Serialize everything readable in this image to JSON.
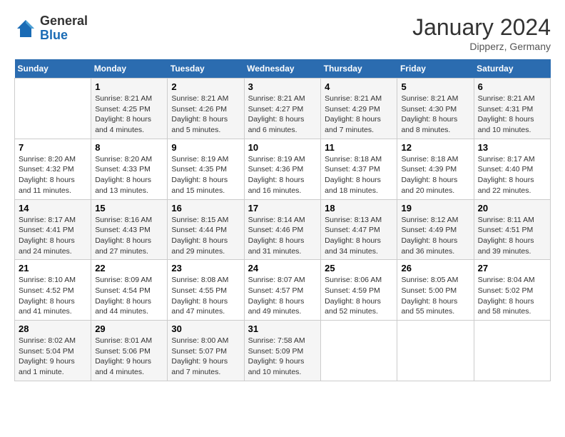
{
  "header": {
    "logo_line1": "General",
    "logo_line2": "Blue",
    "month": "January 2024",
    "location": "Dipperz, Germany"
  },
  "weekdays": [
    "Sunday",
    "Monday",
    "Tuesday",
    "Wednesday",
    "Thursday",
    "Friday",
    "Saturday"
  ],
  "weeks": [
    [
      {
        "day": "",
        "sunrise": "",
        "sunset": "",
        "daylight": ""
      },
      {
        "day": "1",
        "sunrise": "Sunrise: 8:21 AM",
        "sunset": "Sunset: 4:25 PM",
        "daylight": "Daylight: 8 hours and 4 minutes."
      },
      {
        "day": "2",
        "sunrise": "Sunrise: 8:21 AM",
        "sunset": "Sunset: 4:26 PM",
        "daylight": "Daylight: 8 hours and 5 minutes."
      },
      {
        "day": "3",
        "sunrise": "Sunrise: 8:21 AM",
        "sunset": "Sunset: 4:27 PM",
        "daylight": "Daylight: 8 hours and 6 minutes."
      },
      {
        "day": "4",
        "sunrise": "Sunrise: 8:21 AM",
        "sunset": "Sunset: 4:29 PM",
        "daylight": "Daylight: 8 hours and 7 minutes."
      },
      {
        "day": "5",
        "sunrise": "Sunrise: 8:21 AM",
        "sunset": "Sunset: 4:30 PM",
        "daylight": "Daylight: 8 hours and 8 minutes."
      },
      {
        "day": "6",
        "sunrise": "Sunrise: 8:21 AM",
        "sunset": "Sunset: 4:31 PM",
        "daylight": "Daylight: 8 hours and 10 minutes."
      }
    ],
    [
      {
        "day": "7",
        "sunrise": "Sunrise: 8:20 AM",
        "sunset": "Sunset: 4:32 PM",
        "daylight": "Daylight: 8 hours and 11 minutes."
      },
      {
        "day": "8",
        "sunrise": "Sunrise: 8:20 AM",
        "sunset": "Sunset: 4:33 PM",
        "daylight": "Daylight: 8 hours and 13 minutes."
      },
      {
        "day": "9",
        "sunrise": "Sunrise: 8:19 AM",
        "sunset": "Sunset: 4:35 PM",
        "daylight": "Daylight: 8 hours and 15 minutes."
      },
      {
        "day": "10",
        "sunrise": "Sunrise: 8:19 AM",
        "sunset": "Sunset: 4:36 PM",
        "daylight": "Daylight: 8 hours and 16 minutes."
      },
      {
        "day": "11",
        "sunrise": "Sunrise: 8:18 AM",
        "sunset": "Sunset: 4:37 PM",
        "daylight": "Daylight: 8 hours and 18 minutes."
      },
      {
        "day": "12",
        "sunrise": "Sunrise: 8:18 AM",
        "sunset": "Sunset: 4:39 PM",
        "daylight": "Daylight: 8 hours and 20 minutes."
      },
      {
        "day": "13",
        "sunrise": "Sunrise: 8:17 AM",
        "sunset": "Sunset: 4:40 PM",
        "daylight": "Daylight: 8 hours and 22 minutes."
      }
    ],
    [
      {
        "day": "14",
        "sunrise": "Sunrise: 8:17 AM",
        "sunset": "Sunset: 4:41 PM",
        "daylight": "Daylight: 8 hours and 24 minutes."
      },
      {
        "day": "15",
        "sunrise": "Sunrise: 8:16 AM",
        "sunset": "Sunset: 4:43 PM",
        "daylight": "Daylight: 8 hours and 27 minutes."
      },
      {
        "day": "16",
        "sunrise": "Sunrise: 8:15 AM",
        "sunset": "Sunset: 4:44 PM",
        "daylight": "Daylight: 8 hours and 29 minutes."
      },
      {
        "day": "17",
        "sunrise": "Sunrise: 8:14 AM",
        "sunset": "Sunset: 4:46 PM",
        "daylight": "Daylight: 8 hours and 31 minutes."
      },
      {
        "day": "18",
        "sunrise": "Sunrise: 8:13 AM",
        "sunset": "Sunset: 4:47 PM",
        "daylight": "Daylight: 8 hours and 34 minutes."
      },
      {
        "day": "19",
        "sunrise": "Sunrise: 8:12 AM",
        "sunset": "Sunset: 4:49 PM",
        "daylight": "Daylight: 8 hours and 36 minutes."
      },
      {
        "day": "20",
        "sunrise": "Sunrise: 8:11 AM",
        "sunset": "Sunset: 4:51 PM",
        "daylight": "Daylight: 8 hours and 39 minutes."
      }
    ],
    [
      {
        "day": "21",
        "sunrise": "Sunrise: 8:10 AM",
        "sunset": "Sunset: 4:52 PM",
        "daylight": "Daylight: 8 hours and 41 minutes."
      },
      {
        "day": "22",
        "sunrise": "Sunrise: 8:09 AM",
        "sunset": "Sunset: 4:54 PM",
        "daylight": "Daylight: 8 hours and 44 minutes."
      },
      {
        "day": "23",
        "sunrise": "Sunrise: 8:08 AM",
        "sunset": "Sunset: 4:55 PM",
        "daylight": "Daylight: 8 hours and 47 minutes."
      },
      {
        "day": "24",
        "sunrise": "Sunrise: 8:07 AM",
        "sunset": "Sunset: 4:57 PM",
        "daylight": "Daylight: 8 hours and 49 minutes."
      },
      {
        "day": "25",
        "sunrise": "Sunrise: 8:06 AM",
        "sunset": "Sunset: 4:59 PM",
        "daylight": "Daylight: 8 hours and 52 minutes."
      },
      {
        "day": "26",
        "sunrise": "Sunrise: 8:05 AM",
        "sunset": "Sunset: 5:00 PM",
        "daylight": "Daylight: 8 hours and 55 minutes."
      },
      {
        "day": "27",
        "sunrise": "Sunrise: 8:04 AM",
        "sunset": "Sunset: 5:02 PM",
        "daylight": "Daylight: 8 hours and 58 minutes."
      }
    ],
    [
      {
        "day": "28",
        "sunrise": "Sunrise: 8:02 AM",
        "sunset": "Sunset: 5:04 PM",
        "daylight": "Daylight: 9 hours and 1 minute."
      },
      {
        "day": "29",
        "sunrise": "Sunrise: 8:01 AM",
        "sunset": "Sunset: 5:06 PM",
        "daylight": "Daylight: 9 hours and 4 minutes."
      },
      {
        "day": "30",
        "sunrise": "Sunrise: 8:00 AM",
        "sunset": "Sunset: 5:07 PM",
        "daylight": "Daylight: 9 hours and 7 minutes."
      },
      {
        "day": "31",
        "sunrise": "Sunrise: 7:58 AM",
        "sunset": "Sunset: 5:09 PM",
        "daylight": "Daylight: 9 hours and 10 minutes."
      },
      {
        "day": "",
        "sunrise": "",
        "sunset": "",
        "daylight": ""
      },
      {
        "day": "",
        "sunrise": "",
        "sunset": "",
        "daylight": ""
      },
      {
        "day": "",
        "sunrise": "",
        "sunset": "",
        "daylight": ""
      }
    ]
  ]
}
